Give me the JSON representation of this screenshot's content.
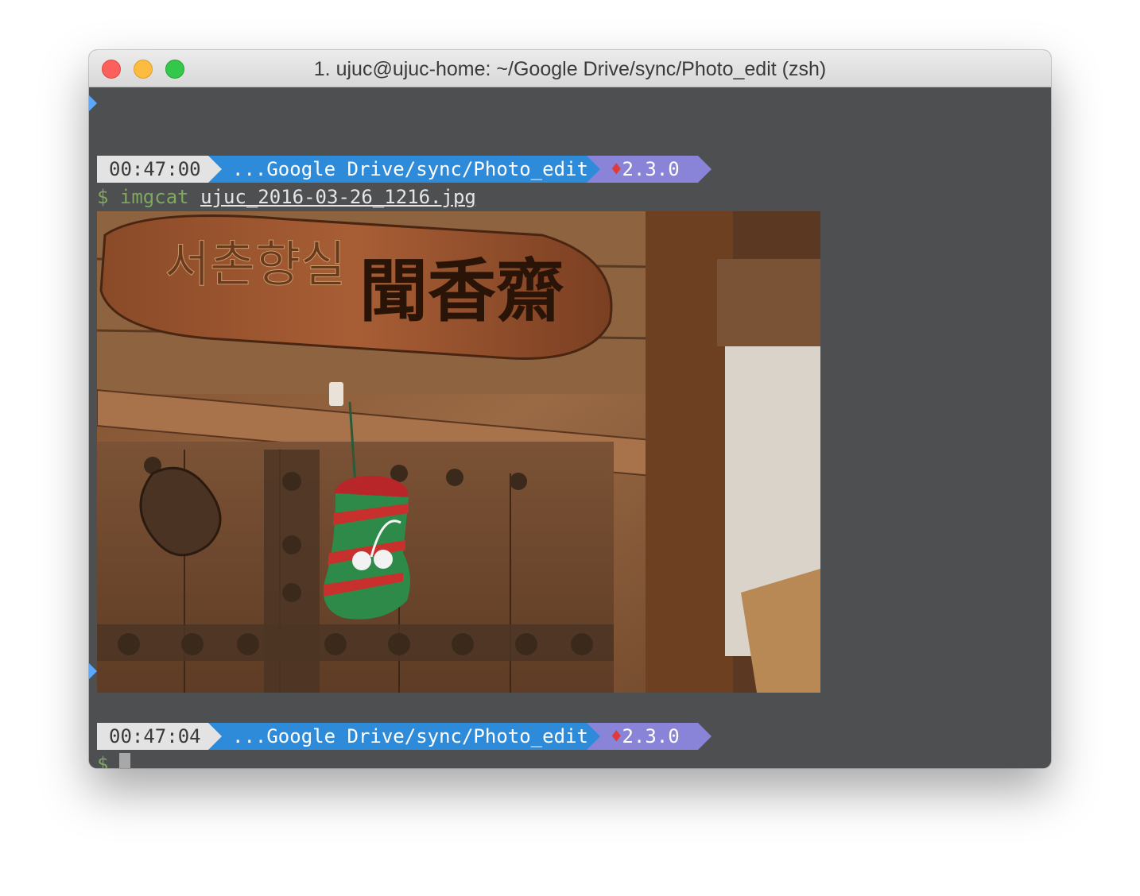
{
  "window": {
    "title": "1. ujuc@ujuc-home: ~/Google Drive/sync/Photo_edit (zsh)"
  },
  "prompts": [
    {
      "time": "00:47:00",
      "path": "...Google Drive/sync/Photo_edit",
      "ruby_icon": "ruby-gem-icon",
      "version": "2.3.0"
    },
    {
      "time": "00:47:04",
      "path": "...Google Drive/sync/Photo_edit",
      "ruby_icon": "ruby-gem-icon",
      "version": "2.3.0"
    }
  ],
  "command": {
    "dollar": "$",
    "name": "imgcat",
    "argument": "ujuc_2016-03-26_1216.jpg"
  },
  "image": {
    "sign_hangul": "서촌향실",
    "sign_hanja": "聞香齋"
  },
  "second_prompt_dollar": "$",
  "colors": {
    "terminal_bg": "#4e4f51",
    "time_segment": "#e3e3e3",
    "path_segment": "#2e8bd9",
    "version_segment": "#8a84d8",
    "prompt_green": "#7fa85d"
  }
}
